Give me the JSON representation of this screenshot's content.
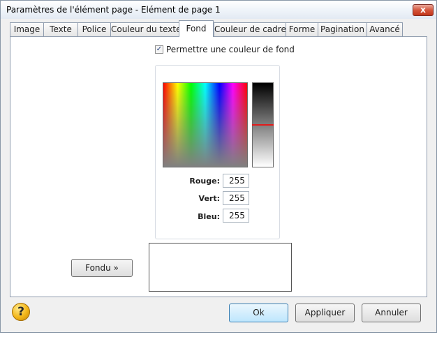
{
  "window": {
    "title": "Paramètres de l'élément page - Elément de page 1",
    "close_glyph": "x"
  },
  "tabs": [
    {
      "label": "Image"
    },
    {
      "label": "Texte"
    },
    {
      "label": "Police"
    },
    {
      "label": "Couleur du texte"
    },
    {
      "label": "Fond",
      "active": true
    },
    {
      "label": "Couleur de cadre"
    },
    {
      "label": "Forme"
    },
    {
      "label": "Pagination"
    },
    {
      "label": "Avancé"
    }
  ],
  "background": {
    "allow_checkbox": {
      "label": "Permettre une couleur de fond",
      "checked": true,
      "glyph": "✓"
    },
    "color": {
      "red_label": "Rouge:",
      "red": "255",
      "green_label": "Vert:",
      "green": "255",
      "blue_label": "Bleu:",
      "blue": "255"
    },
    "fade_button": "Fondu »",
    "luminance_marker_color": "#e21b1b"
  },
  "footer": {
    "help_glyph": "?",
    "ok": "Ok",
    "apply": "Appliquer",
    "cancel": "Annuler"
  }
}
